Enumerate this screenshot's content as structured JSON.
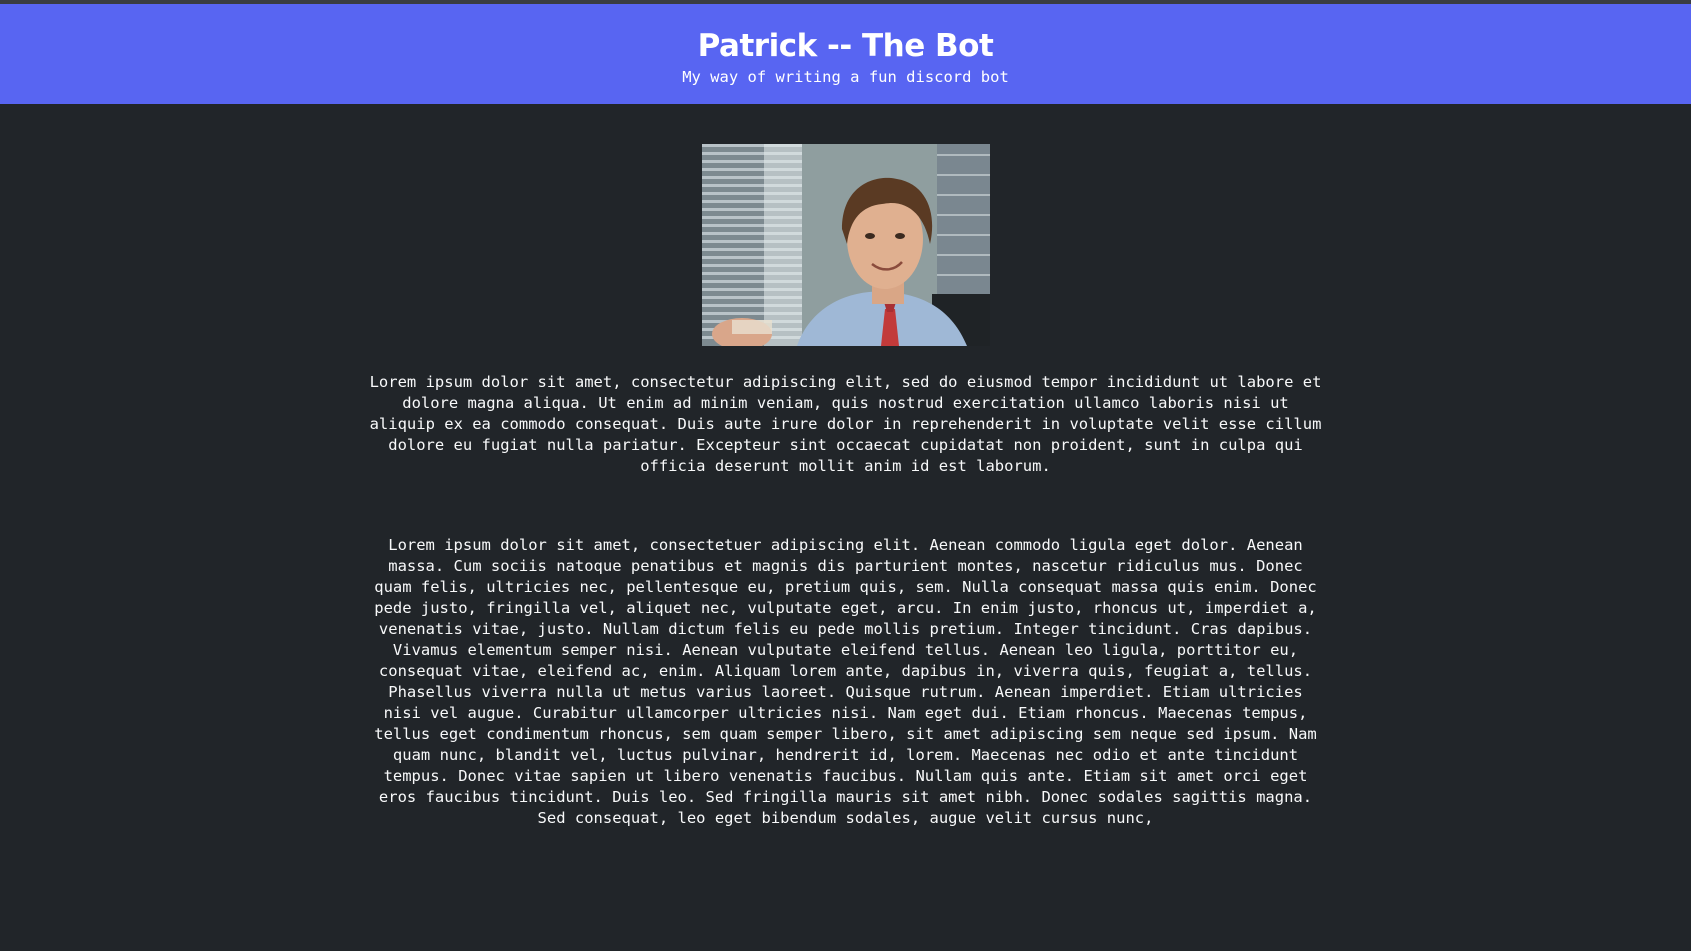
{
  "header": {
    "title": "Patrick -- The Bot",
    "subtitle": "My way of writing a fun discord bot"
  },
  "main": {
    "image": {
      "icon": "portrait-image"
    },
    "paragraph_1": "Lorem ipsum dolor sit amet, consectetur adipiscing elit, sed do eiusmod tempor incididunt ut labore et dolore magna aliqua. Ut enim ad minim veniam, quis nostrud exercitation ullamco laboris nisi ut aliquip ex ea commodo consequat. Duis aute irure dolor in reprehenderit in voluptate velit esse cillum dolore eu fugiat nulla pariatur. Excepteur sint occaecat cupidatat non proident, sunt in culpa qui officia deserunt mollit anim id est laborum.",
    "paragraph_2": "Lorem ipsum dolor sit amet, consectetuer adipiscing elit. Aenean commodo ligula eget dolor. Aenean massa. Cum sociis natoque penatibus et magnis dis parturient montes, nascetur ridiculus mus. Donec quam felis, ultricies nec, pellentesque eu, pretium quis, sem. Nulla consequat massa quis enim. Donec pede justo, fringilla vel, aliquet nec, vulputate eget, arcu. In enim justo, rhoncus ut, imperdiet a, venenatis vitae, justo. Nullam dictum felis eu pede mollis pretium. Integer tincidunt. Cras dapibus. Vivamus elementum semper nisi. Aenean vulputate eleifend tellus. Aenean leo ligula, porttitor eu, consequat vitae, eleifend ac, enim. Aliquam lorem ante, dapibus in, viverra quis, feugiat a, tellus. Phasellus viverra nulla ut metus varius laoreet. Quisque rutrum. Aenean imperdiet. Etiam ultricies nisi vel augue. Curabitur ullamcorper ultricies nisi. Nam eget dui. Etiam rhoncus. Maecenas tempus, tellus eget condimentum rhoncus, sem quam semper libero, sit amet adipiscing sem neque sed ipsum. Nam quam nunc, blandit vel, luctus pulvinar, hendrerit id, lorem. Maecenas nec odio et ante tincidunt tempus. Donec vitae sapien ut libero venenatis faucibus. Nullam quis ante. Etiam sit amet orci eget eros faucibus tincidunt. Duis leo. Sed fringilla mauris sit amet nibh. Donec sodales sagittis magna. Sed consequat, leo eget bibendum sodales, augue velit cursus nunc,"
  },
  "colors": {
    "header_bg": "#5865f2",
    "page_bg": "#212529",
    "text": "#f8f9fa"
  }
}
